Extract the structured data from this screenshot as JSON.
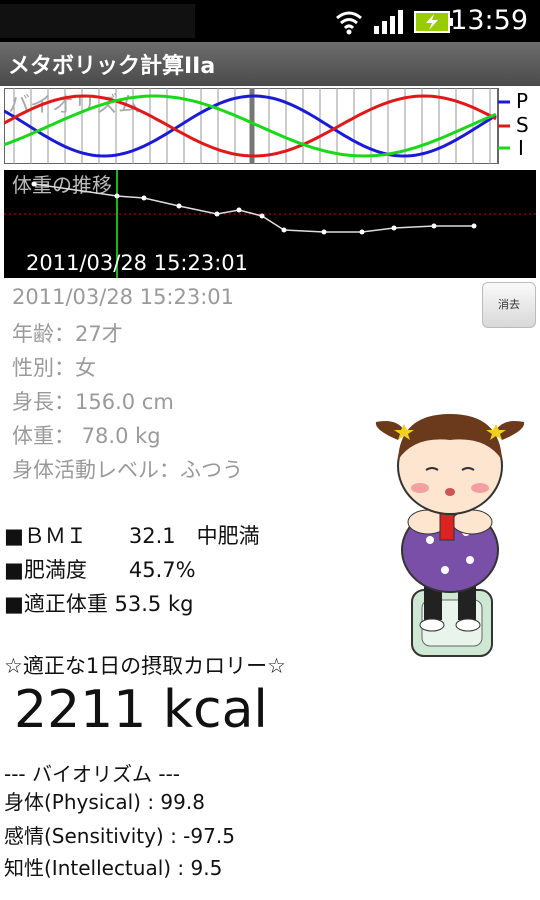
{
  "status": {
    "time": "13:59"
  },
  "app": {
    "title": "メタボリック計算IIa"
  },
  "biorhythm_chart": {
    "label": "バイオリズム",
    "legend": [
      "P",
      "S",
      "I"
    ],
    "colors": {
      "P": "#1a1ad8",
      "S": "#e01818",
      "I": "#18d818"
    }
  },
  "weight_chart": {
    "label": "体重の推移",
    "timestamp": "2011/03/28 15:23:01"
  },
  "profile": {
    "datetime": "2011/03/28 15:23:01",
    "age": "年齢：27才",
    "sex": "性別：女",
    "height": "身長：156.0 cm",
    "weight": "体重： 78.0 kg",
    "activity": "身体活動レベル：ふつう"
  },
  "delete_button": "消去",
  "results": {
    "bmi": "■ＢＭＩ　　32.1　中肥満",
    "obesity": "■肥満度　　45.7%",
    "ideal_weight": "■適正体重 53.5 kg"
  },
  "calorie": {
    "heading": "☆適正な1日の摂取カロリー☆",
    "value": "2211 kcal"
  },
  "biorhythm": {
    "heading": "--- バイオリズム ---",
    "physical": "身体(Physical) :  99.8",
    "sensitivity": "感情(Sensitivity) : -97.5",
    "intellectual": "知性(Intellectual) :   9.5"
  }
}
